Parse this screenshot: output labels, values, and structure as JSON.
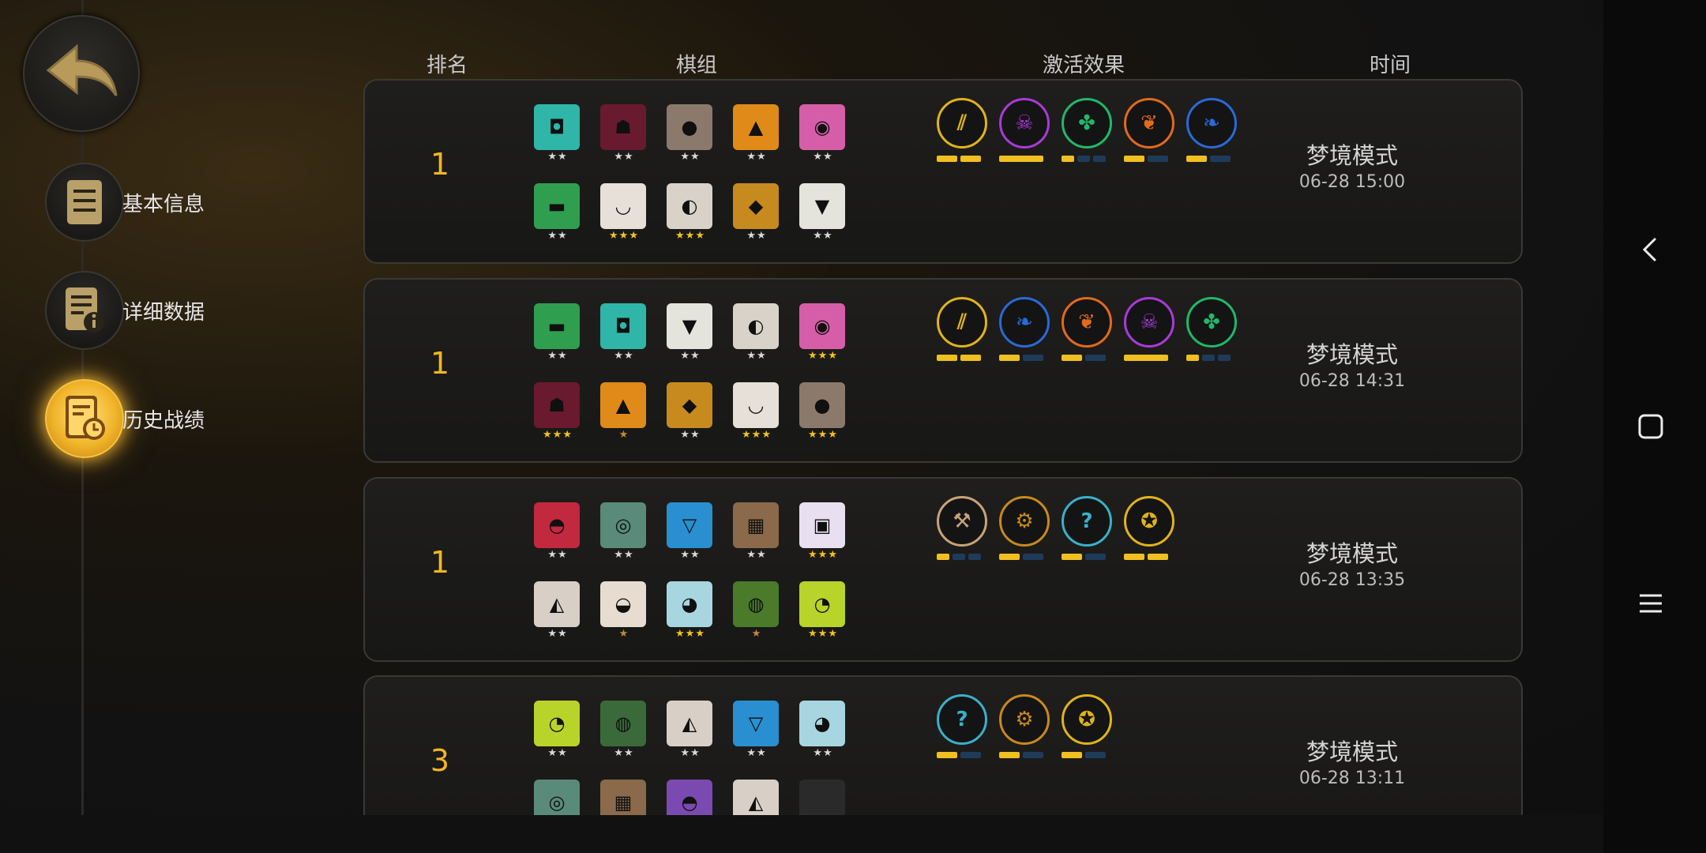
{
  "header": {
    "rank": "排名",
    "comp": "棋组",
    "traits": "激活效果",
    "time": "时间"
  },
  "menu": [
    {
      "label": "基本信息",
      "icon": "document-icon",
      "active": false
    },
    {
      "label": "详细数据",
      "icon": "info-document-icon",
      "active": false
    },
    {
      "label": "历史战绩",
      "icon": "clock-document-icon",
      "active": true
    }
  ],
  "matches": [
    {
      "rank": "1",
      "mode": "梦境模式",
      "time": "06-28 15:00",
      "units": [
        {
          "c": "#2fb6a8",
          "g": "◘",
          "s": "★★",
          "gold": false
        },
        {
          "c": "#6a1a2e",
          "g": "☗",
          "s": "★★",
          "gold": false
        },
        {
          "c": "#8b7a6b",
          "g": "●",
          "s": "★★",
          "gold": false
        },
        {
          "c": "#e08a1a",
          "g": "▲",
          "s": "★★",
          "gold": false
        },
        {
          "c": "#d65ea9",
          "g": "◉",
          "s": "★★",
          "gold": false
        },
        {
          "c": "#2f9e4f",
          "g": "▬",
          "s": "★★",
          "gold": false
        },
        {
          "c": "#e6e0d8",
          "g": "◡",
          "s": "★★★",
          "gold": true
        },
        {
          "c": "#d8d2c8",
          "g": "◐",
          "s": "★★★",
          "gold": true
        },
        {
          "c": "#c78a1e",
          "g": "◆",
          "s": "★★",
          "gold": false
        },
        {
          "c": "#e4e4dc",
          "g": "▼",
          "s": "★★",
          "gold": false
        }
      ],
      "traits": [
        {
          "c": "#e0b31a",
          "g": "⫽",
          "bars": [
            1,
            1
          ],
          "fill": 2
        },
        {
          "c": "#a83bd9",
          "g": "☠",
          "bars": [
            1
          ],
          "fill": 1
        },
        {
          "c": "#20b86a",
          "g": "✤",
          "bars": [
            1,
            1,
            1
          ],
          "fill": 1
        },
        {
          "c": "#e06a1e",
          "g": "❦",
          "bars": [
            1,
            1
          ],
          "fill": 1
        },
        {
          "c": "#2a6ad8",
          "g": "❧",
          "bars": [
            1,
            1
          ],
          "fill": 1
        }
      ]
    },
    {
      "rank": "1",
      "mode": "梦境模式",
      "time": "06-28 14:31",
      "units": [
        {
          "c": "#2f9e4f",
          "g": "▬",
          "s": "★★",
          "gold": false
        },
        {
          "c": "#2fb6a8",
          "g": "◘",
          "s": "★★",
          "gold": false
        },
        {
          "c": "#e4e4dc",
          "g": "▼",
          "s": "★★",
          "gold": false
        },
        {
          "c": "#d8d2c8",
          "g": "◐",
          "s": "★★",
          "gold": false
        },
        {
          "c": "#d65ea9",
          "g": "◉",
          "s": "★★★",
          "gold": true
        },
        {
          "c": "#6a1a2e",
          "g": "☗",
          "s": "★★★",
          "gold": true
        },
        {
          "c": "#e08a1a",
          "g": "▲",
          "s": "★",
          "gold": false,
          "bronze": true
        },
        {
          "c": "#c78a1e",
          "g": "◆",
          "s": "★★",
          "gold": false
        },
        {
          "c": "#e6e0d8",
          "g": "◡",
          "s": "★★★",
          "gold": true
        },
        {
          "c": "#8b7a6b",
          "g": "●",
          "s": "★★★",
          "gold": true
        }
      ],
      "traits": [
        {
          "c": "#e0b31a",
          "g": "⫽",
          "bars": [
            1,
            1
          ],
          "fill": 2
        },
        {
          "c": "#2a6ad8",
          "g": "❧",
          "bars": [
            1,
            1
          ],
          "fill": 1
        },
        {
          "c": "#e06a1e",
          "g": "❦",
          "bars": [
            1,
            1
          ],
          "fill": 1
        },
        {
          "c": "#a83bd9",
          "g": "☠",
          "bars": [
            1
          ],
          "fill": 1
        },
        {
          "c": "#20b86a",
          "g": "✤",
          "bars": [
            1,
            1,
            1
          ],
          "fill": 1
        }
      ]
    },
    {
      "rank": "1",
      "mode": "梦境模式",
      "time": "06-28 13:35",
      "units": [
        {
          "c": "#c2283e",
          "g": "◓",
          "s": "★★",
          "gold": false
        },
        {
          "c": "#5a8a7a",
          "g": "◎",
          "s": "★★",
          "gold": false
        },
        {
          "c": "#2a8fd0",
          "g": "▽",
          "s": "★★",
          "gold": false
        },
        {
          "c": "#8a6a4a",
          "g": "▦",
          "s": "★★",
          "gold": false
        },
        {
          "c": "#e8e0f0",
          "g": "▣",
          "s": "★★★",
          "gold": true
        },
        {
          "c": "#d8cfc7",
          "g": "◭",
          "s": "★★",
          "gold": false
        },
        {
          "c": "#e6dcd0",
          "g": "◒",
          "s": "★",
          "gold": false,
          "bronze": true
        },
        {
          "c": "#a8d6e0",
          "g": "◕",
          "s": "★★★",
          "gold": true
        },
        {
          "c": "#4a7a2a",
          "g": "◍",
          "s": "★",
          "gold": false,
          "bronze": true
        },
        {
          "c": "#b8d42a",
          "g": "◔",
          "s": "★★★",
          "gold": true
        }
      ],
      "traits": [
        {
          "c": "#c8a27a",
          "g": "⚒",
          "bars": [
            1,
            1,
            1
          ],
          "fill": 1
        },
        {
          "c": "#c8891e",
          "g": "⚙",
          "bars": [
            1,
            1
          ],
          "fill": 1
        },
        {
          "c": "#3ab0c8",
          "g": "?",
          "bars": [
            1,
            1
          ],
          "fill": 1
        },
        {
          "c": "#e0b31a",
          "g": "✪",
          "bars": [
            1,
            1
          ],
          "fill": 2
        }
      ]
    },
    {
      "rank": "3",
      "mode": "梦境模式",
      "time": "06-28 13:11",
      "units": [
        {
          "c": "#b8d42a",
          "g": "◔",
          "s": "★★",
          "gold": false
        },
        {
          "c": "#3a6a3a",
          "g": "◍",
          "s": "★★",
          "gold": false
        },
        {
          "c": "#d8cfc7",
          "g": "◭",
          "s": "★★",
          "gold": false
        },
        {
          "c": "#2a8fd0",
          "g": "▽",
          "s": "★★",
          "gold": false
        },
        {
          "c": "#a8d6e0",
          "g": "◕",
          "s": "★★",
          "gold": false
        },
        {
          "c": "#5a8a7a",
          "g": "◎",
          "s": "",
          "gold": false
        },
        {
          "c": "#8a6a4a",
          "g": "▦",
          "s": "",
          "gold": false
        },
        {
          "c": "#7a4ab0",
          "g": "◓",
          "s": "",
          "gold": false
        },
        {
          "c": "#d8cfc7",
          "g": "◭",
          "s": "",
          "gold": false
        },
        {
          "c": "#2a2a2a",
          "g": "",
          "s": "",
          "gold": false
        }
      ],
      "traits": [
        {
          "c": "#3ab0c8",
          "g": "?",
          "bars": [
            1,
            1
          ],
          "fill": 1
        },
        {
          "c": "#c8891e",
          "g": "⚙",
          "bars": [
            1,
            1
          ],
          "fill": 1
        },
        {
          "c": "#e0b31a",
          "g": "✪",
          "bars": [
            1,
            1
          ],
          "fill": 1
        }
      ]
    }
  ]
}
